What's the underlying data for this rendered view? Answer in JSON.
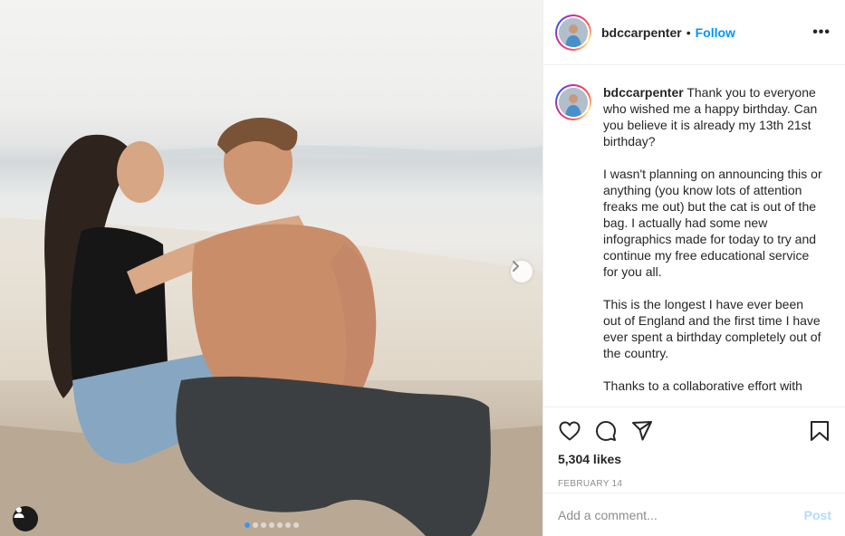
{
  "post": {
    "username": "bdccarpenter",
    "separator": "•",
    "follow_label": "Follow",
    "more_icon": "more-options-icon",
    "more_label": "•••"
  },
  "caption": {
    "username": "bdccarpenter",
    "paragraphs": [
      "Thank you to everyone who wished me a happy birthday. Can you believe it is already my 13th 21st birthday?",
      "I wasn't planning on announcing this or anything (you know lots of attention freaks me out) but the cat is out of the bag. I actually had some new infographics made for today to try and continue my free educational service for you all.",
      "This is the longest I have ever been out of England and the first time I have ever spent a birthday completely out of the country.",
      "Thanks to a collaborative effort with"
    ]
  },
  "actions": {
    "like_icon": "heart-icon",
    "comment_icon": "comment-icon",
    "share_icon": "paper-plane-icon",
    "save_icon": "bookmark-icon",
    "likes_text": "5,304 likes",
    "date_text": "FEBRUARY 14"
  },
  "comment": {
    "placeholder": "Add a comment...",
    "post_label": "Post"
  },
  "carousel": {
    "slide_count": 7,
    "active_index": 0,
    "next_icon": "chevron-right-icon",
    "tags_icon": "user-tag-icon"
  },
  "colors": {
    "accent": "#0095f6",
    "post_disabled": "#b3dbff",
    "carousel_active": "#3897f0"
  }
}
